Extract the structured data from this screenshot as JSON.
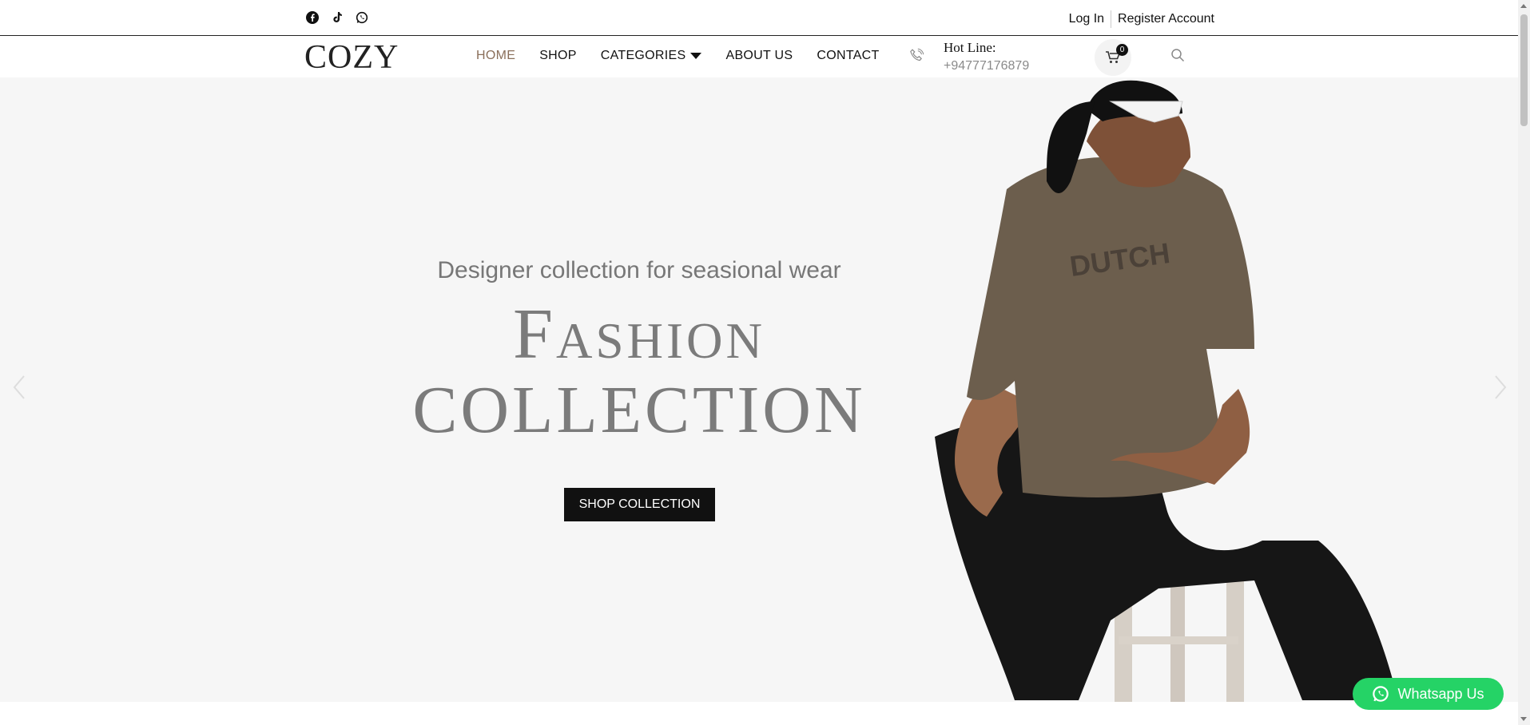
{
  "topbar": {
    "social_icons": [
      "facebook-icon",
      "tiktok-icon",
      "whatsapp-icon"
    ],
    "login": "Log In",
    "register": "Register Account"
  },
  "nav": {
    "logo": "COZY",
    "items": [
      "HOME",
      "SHOP",
      "CATEGORIES",
      "ABOUT US",
      "CONTACT"
    ],
    "active": "HOME",
    "hotline_label": "Hot Line:",
    "hotline_number": "+94777176879",
    "cart_count": "0"
  },
  "hero": {
    "subheading": "Designer collection for seasional wear",
    "headline_1": "Fashion",
    "headline_2": "COLLECTION",
    "cta": "SHOP COLLECTION"
  },
  "whatsapp": {
    "label": "Whatsapp Us"
  },
  "colors": {
    "accent": "#8a6f5a",
    "whatsapp": "#25d366",
    "hero_bg": "#f6f6f6",
    "button": "#111111"
  }
}
